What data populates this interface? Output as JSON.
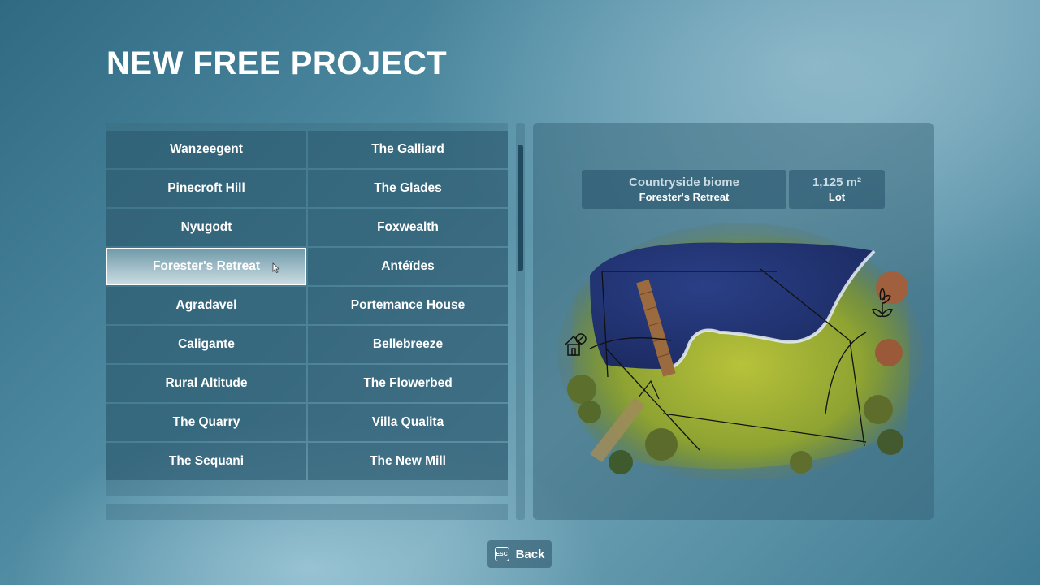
{
  "header": {
    "title": "NEW FREE PROJECT"
  },
  "projects": {
    "left": [
      "Wanzeegent",
      "Pinecroft Hill",
      "Nyugodt",
      "Forester's Retreat",
      "Agradavel",
      "Caligante",
      "Rural Altitude",
      "The Quarry",
      "The Sequani"
    ],
    "right": [
      "The Galliard",
      "The Glades",
      "Foxwealth",
      "Antéïdes",
      "Portemance House",
      "Bellebreeze",
      "The Flowerbed",
      "Villa Qualita",
      "The New Mill"
    ],
    "selected": "Forester's Retreat"
  },
  "details": {
    "biome": "Countryside biome",
    "name": "Forester's Retreat",
    "area": "1,125 m²",
    "area_label": "Lot"
  },
  "footer": {
    "esc_key": "ESC",
    "back_label": "Back"
  },
  "icons": {
    "map_left": "house-icon",
    "map_right": "flower-icon",
    "cursor": "mouse-cursor-icon"
  }
}
